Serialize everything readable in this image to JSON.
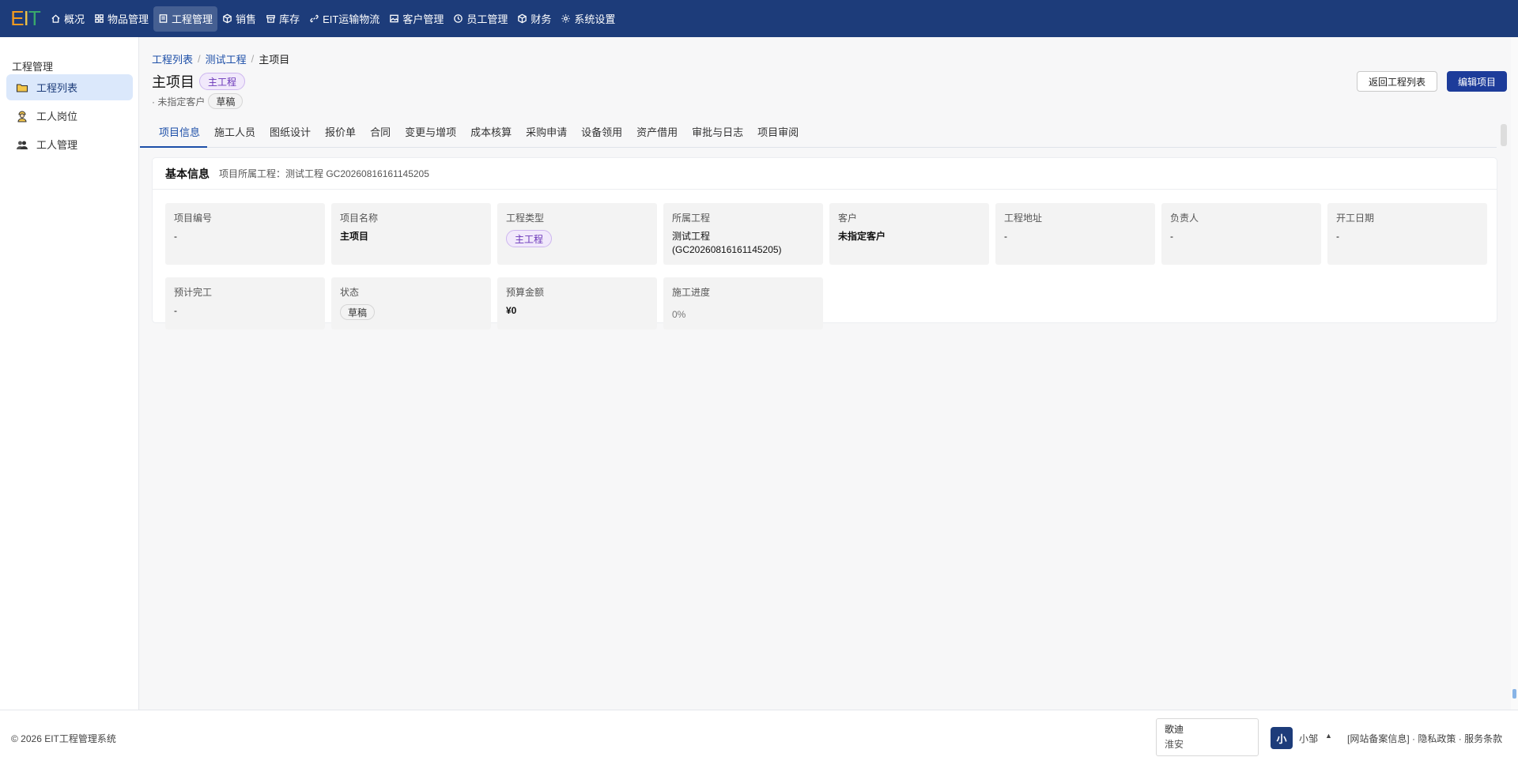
{
  "logo": {
    "e": "E",
    "i": "I",
    "t": "T"
  },
  "nav": [
    {
      "label": "概况",
      "icon": "home-icon"
    },
    {
      "label": "物品管理",
      "icon": "grid-icon"
    },
    {
      "label": "工程管理",
      "icon": "document-icon",
      "active": true
    },
    {
      "label": "销售",
      "icon": "box-icon"
    },
    {
      "label": "库存",
      "icon": "archive-icon"
    },
    {
      "label": "EIT运输物流",
      "icon": "link-icon"
    },
    {
      "label": "客户管理",
      "icon": "image-icon"
    },
    {
      "label": "员工管理",
      "icon": "clock-icon"
    },
    {
      "label": "财务",
      "icon": "cube-icon"
    },
    {
      "label": "系统设置",
      "icon": "settings-icon"
    }
  ],
  "sidebar": {
    "title": "工程管理",
    "items": [
      {
        "label": "工程列表",
        "icon": "folder-icon",
        "active": true
      },
      {
        "label": "工人岗位",
        "icon": "worker-icon"
      },
      {
        "label": "工人管理",
        "icon": "group-icon"
      }
    ]
  },
  "breadcrumb": {
    "l1": "工程列表",
    "l2": "测试工程",
    "current": "主项目",
    "sep": "/"
  },
  "header": {
    "title": "主项目",
    "type_tag": "主工程",
    "customer": "· 未指定客户",
    "status_tag": "草稿",
    "back_button": "返回工程列表",
    "edit_button": "编辑项目"
  },
  "tabs": [
    "项目信息",
    "施工人员",
    "图纸设计",
    "报价单",
    "合同",
    "变更与增项",
    "成本核算",
    "采购申请",
    "设备领用",
    "资产借用",
    "审批与日志",
    "项目审阅"
  ],
  "card": {
    "title": "基本信息",
    "meta": "项目所属工程：测试工程 GC20260816161145205",
    "fields": [
      {
        "label": "项目编号",
        "value": "-"
      },
      {
        "label": "项目名称",
        "value": "主项目"
      },
      {
        "label": "工程类型",
        "value": "主工程"
      },
      {
        "label": "所属工程",
        "value": "测试工程",
        "value2": "(GC20260816161145205)"
      },
      {
        "label": "客户",
        "value": "未指定客户"
      },
      {
        "label": "工程地址",
        "value": "-"
      },
      {
        "label": "负责人",
        "value": "-"
      },
      {
        "label": "开工日期",
        "value": "-"
      },
      {
        "label": "预计完工",
        "value": "-"
      },
      {
        "label": "状态",
        "value": "草稿"
      },
      {
        "label": "预算金额",
        "value": "¥0"
      },
      {
        "label": "施工进度",
        "value": "0%"
      }
    ]
  },
  "footer": {
    "copyright": "© 2026 EIT工程管理系统",
    "user_line1": "歌迪",
    "user_line2": "淮安",
    "avatar": "小",
    "username": "小邹",
    "caret": "▲",
    "links": {
      "beian": "[网站备案信息]",
      "privacy": "隐私政策",
      "terms": "服务条款",
      "dot": "·"
    }
  }
}
